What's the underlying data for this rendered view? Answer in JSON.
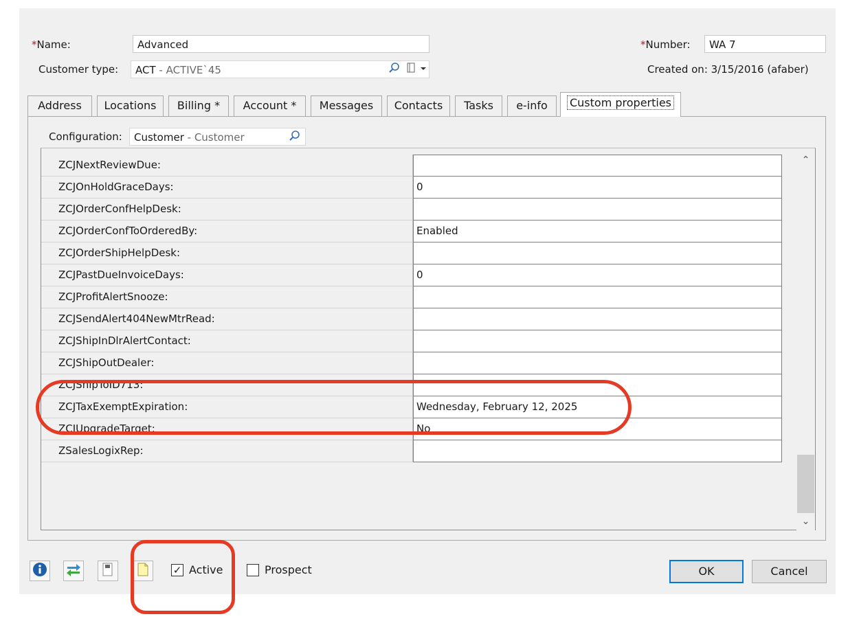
{
  "header": {
    "name_required_mark": "*",
    "name_label": "Name:",
    "name_value": "Advanced",
    "customer_type_label": "Customer type:",
    "customer_type_code": "ACT",
    "customer_type_desc": " - ACTIVE`45",
    "number_required_mark": "*",
    "number_label": "Number:",
    "number_value": "WA 7",
    "created_on": "Created on: 3/15/2016 (afaber)"
  },
  "tabs": [
    {
      "label": "Address"
    },
    {
      "label": "Locations"
    },
    {
      "label": "Billing *"
    },
    {
      "label": "Account *"
    },
    {
      "label": "Messages"
    },
    {
      "label": "Contacts"
    },
    {
      "label": "Tasks"
    },
    {
      "label": "e-info"
    },
    {
      "label": "Custom properties",
      "active": true
    }
  ],
  "configuration": {
    "label": "Configuration:",
    "value": "Customer",
    "desc": " - Customer"
  },
  "properties": [
    {
      "name": "ZCJNextReviewDue:",
      "value": ""
    },
    {
      "name": "ZCJOnHoldGraceDays:",
      "value": "0"
    },
    {
      "name": "ZCJOrderConfHelpDesk:",
      "value": ""
    },
    {
      "name": "ZCJOrderConfToOrderedBy:",
      "value": "Enabled"
    },
    {
      "name": "ZCJOrderShipHelpDesk:",
      "value": ""
    },
    {
      "name": "ZCJPastDueInvoiceDays:",
      "value": "0"
    },
    {
      "name": "ZCJProfitAlertSnooze:",
      "value": ""
    },
    {
      "name": "ZCJSendAlert404NewMtrRead:",
      "value": ""
    },
    {
      "name": "ZCJShipInDlrAlertContact:",
      "value": ""
    },
    {
      "name": "ZCJShipOutDealer:",
      "value": ""
    },
    {
      "name": "ZCJShipToID713:",
      "value": ""
    },
    {
      "name": "ZCJTaxExemptExpiration:",
      "value": "Wednesday, February 12, 2025"
    },
    {
      "name": "ZCJUpgradeTarget:",
      "value": "No"
    },
    {
      "name": "ZSalesLogixRep:",
      "value": ""
    }
  ],
  "footer": {
    "active_label": "Active",
    "active_checked": true,
    "prospect_label": "Prospect",
    "prospect_checked": false,
    "ok_label": "OK",
    "cancel_label": "Cancel"
  },
  "colors": {
    "annotation": "#e53a24",
    "ok_border": "#0078d7",
    "required": "#cc1111"
  }
}
